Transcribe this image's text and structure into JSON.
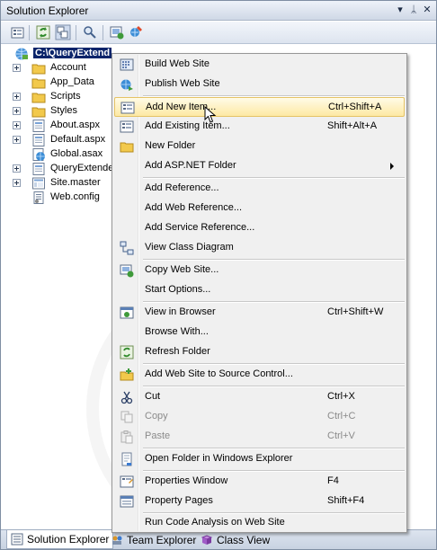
{
  "window": {
    "title": "Solution Explorer",
    "controls": [
      "▾",
      "ᛦ",
      "✕"
    ]
  },
  "toolbar": {
    "buttons": [
      "properties-icon",
      "refresh-icon",
      "nest-files-icon",
      "view-class-diagram-icon",
      "copy-web-site-icon",
      "asp-net-configuration-icon"
    ]
  },
  "tree": {
    "root": "C:\\QueryExtend",
    "items": [
      {
        "label": "Account",
        "type": "folder",
        "expandable": true
      },
      {
        "label": "App_Data",
        "type": "folder",
        "expandable": false
      },
      {
        "label": "Scripts",
        "type": "folder",
        "expandable": true
      },
      {
        "label": "Styles",
        "type": "folder",
        "expandable": true
      },
      {
        "label": "About.aspx",
        "type": "page",
        "expandable": true
      },
      {
        "label": "Default.aspx",
        "type": "page",
        "expandable": true
      },
      {
        "label": "Global.asax",
        "type": "global",
        "expandable": false
      },
      {
        "label": "QueryExtende",
        "type": "page",
        "expandable": true
      },
      {
        "label": "Site.master",
        "type": "master",
        "expandable": true
      },
      {
        "label": "Web.config",
        "type": "config",
        "expandable": false
      }
    ]
  },
  "menu": {
    "items": [
      {
        "label": "Build Web Site",
        "shortcut": "",
        "icon": "build-icon"
      },
      {
        "label": "Publish Web Site",
        "shortcut": "",
        "icon": "publish-icon"
      },
      {
        "label": "Add New Item...",
        "shortcut": "Ctrl+Shift+A",
        "icon": "add-new-item-icon"
      },
      {
        "label": "Add Existing Item...",
        "shortcut": "Shift+Alt+A",
        "icon": "add-existing-item-icon"
      },
      {
        "label": "New Folder",
        "shortcut": "",
        "icon": "new-folder-icon"
      },
      {
        "label": "Add ASP.NET Folder",
        "shortcut": "",
        "icon": ""
      },
      {
        "label": "Add Reference...",
        "shortcut": "",
        "icon": ""
      },
      {
        "label": "Add Web Reference...",
        "shortcut": "",
        "icon": ""
      },
      {
        "label": "Add Service Reference...",
        "shortcut": "",
        "icon": ""
      },
      {
        "label": "View Class Diagram",
        "shortcut": "",
        "icon": "class-diagram-icon"
      },
      {
        "label": "Copy Web Site...",
        "shortcut": "",
        "icon": "copy-web-site-icon"
      },
      {
        "label": "Start Options...",
        "shortcut": "",
        "icon": ""
      },
      {
        "label": "View in Browser",
        "shortcut": "Ctrl+Shift+W",
        "icon": "view-in-browser-icon"
      },
      {
        "label": "Browse With...",
        "shortcut": "",
        "icon": ""
      },
      {
        "label": "Refresh Folder",
        "shortcut": "",
        "icon": "refresh-icon"
      },
      {
        "label": "Add Web Site to Source Control...",
        "shortcut": "",
        "icon": "source-control-icon"
      },
      {
        "label": "Cut",
        "shortcut": "Ctrl+X",
        "icon": "scissors-icon"
      },
      {
        "label": "Copy",
        "shortcut": "Ctrl+C",
        "icon": "copy-icon"
      },
      {
        "label": "Paste",
        "shortcut": "Ctrl+V",
        "icon": "paste-icon"
      },
      {
        "label": "Open Folder in Windows Explorer",
        "shortcut": "",
        "icon": "open-folder-icon"
      },
      {
        "label": "Properties Window",
        "shortcut": "F4",
        "icon": "properties-window-icon"
      },
      {
        "label": "Property Pages",
        "shortcut": "Shift+F4",
        "icon": "property-pages-icon"
      },
      {
        "label": "Run Code Analysis on Web Site",
        "shortcut": "",
        "icon": ""
      }
    ]
  },
  "bottom_tabs": [
    {
      "label": "Solution Explorer",
      "icon": "solution-explorer-icon"
    },
    {
      "label": "Team Explorer",
      "icon": "team-explorer-icon"
    },
    {
      "label": "Class View",
      "icon": "class-view-icon"
    }
  ]
}
